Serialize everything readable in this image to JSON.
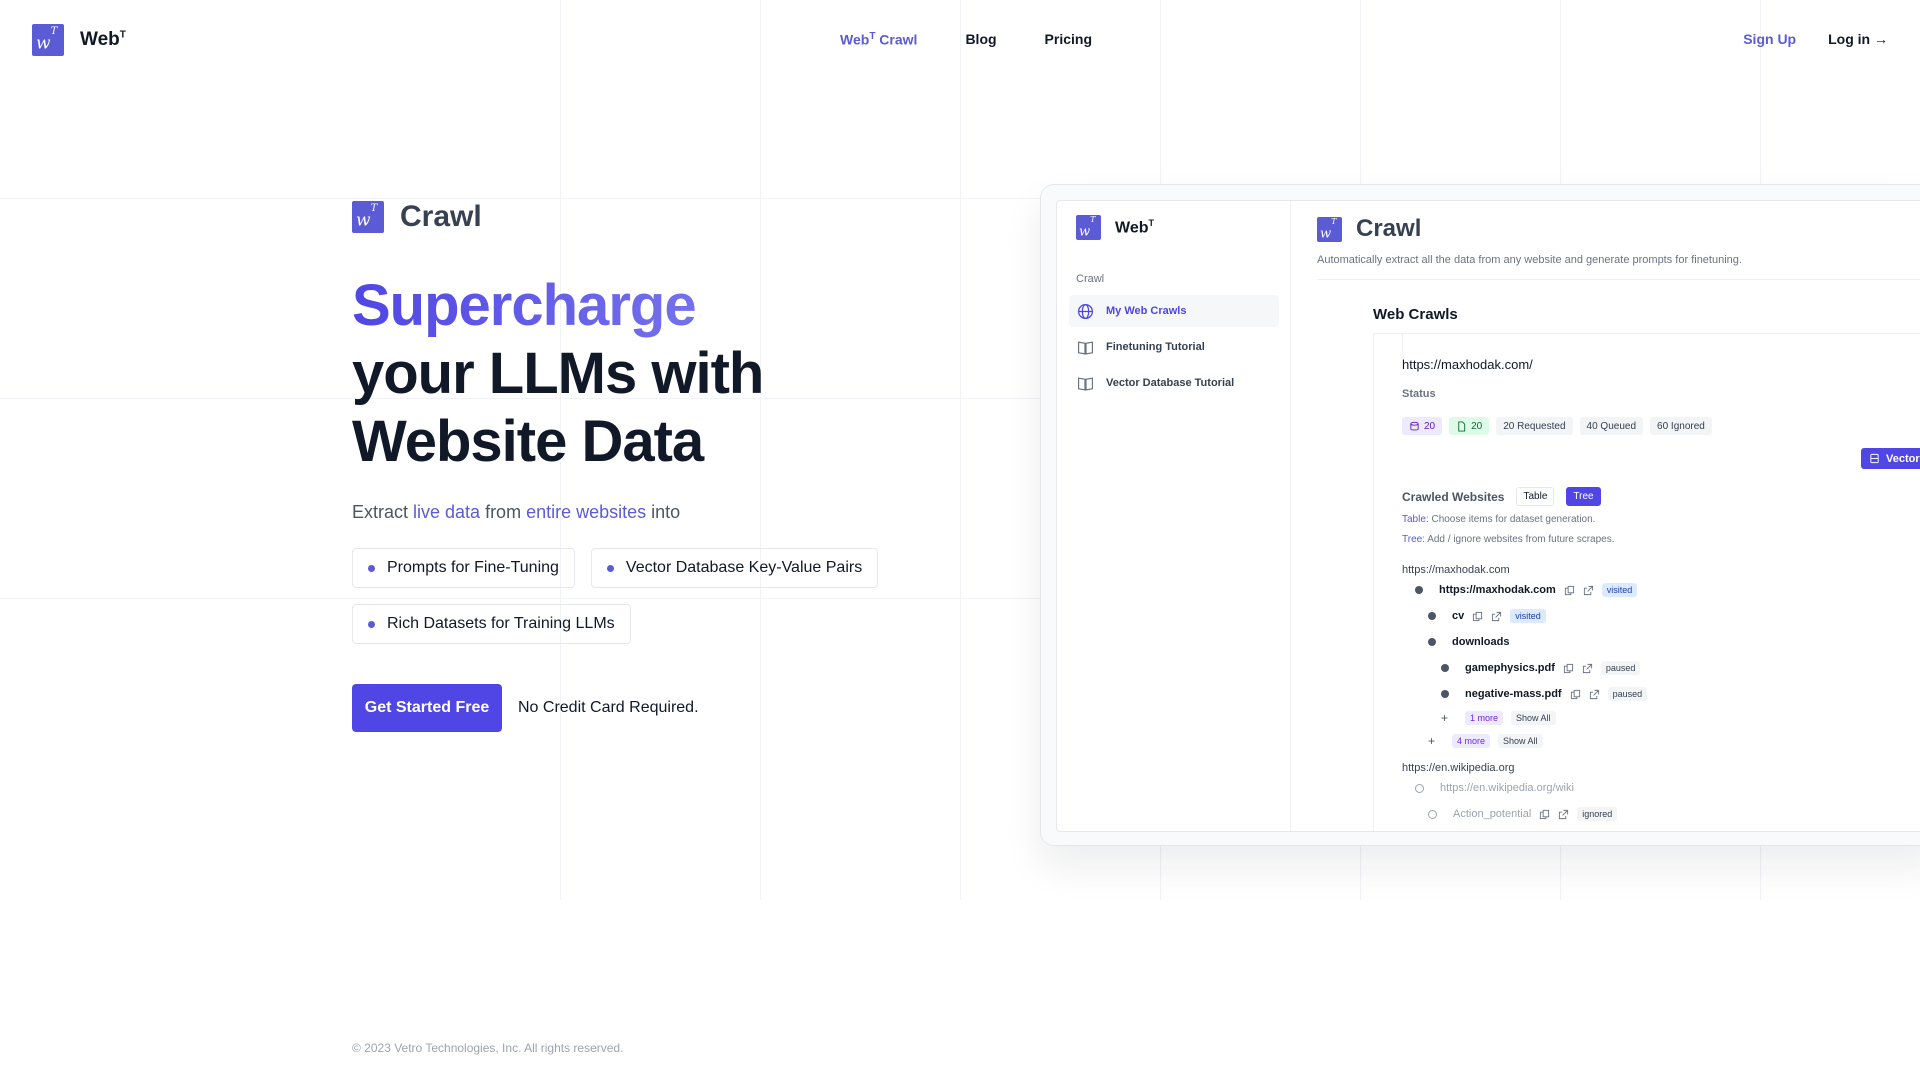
{
  "nav": {
    "brand": "Web",
    "brand_sup": "T",
    "links": [
      {
        "label": "Web",
        "sup": "T",
        "suffix": " Crawl"
      },
      {
        "label": "Blog"
      },
      {
        "label": "Pricing"
      }
    ],
    "signup": "Sign Up",
    "login": "Log in →"
  },
  "hero": {
    "product": "Crawl",
    "title_highlight": "Supercharge",
    "title_line2": "your LLMs with",
    "title_line3": "Website Data",
    "sub_prefix": "Extract ",
    "sub_hl1": "live data",
    "sub_mid": " from ",
    "sub_hl2": "entire websites",
    "sub_suffix": " into",
    "pills": [
      "Prompts for Fine-Tuning",
      "Vector Database Key-Value Pairs",
      "Rich Datasets for Training LLMs"
    ],
    "cta": "Get Started Free",
    "cta_note": "No Credit Card Required."
  },
  "footer": "© 2023 Vetro Technologies, Inc. All rights reserved.",
  "preview": {
    "side_brand": "Web",
    "side_brand_sup": "T",
    "side_label": "Crawl",
    "side_items": [
      "My Web Crawls",
      "Finetuning Tutorial",
      "Vector Database Tutorial"
    ],
    "title": "Crawl",
    "desc": "Automatically extract all the data from any website and generate prompts for finetuning.",
    "web_crawls": "Web Crawls",
    "url": "https://maxhodak.com/",
    "status_label": "Status",
    "badges": [
      "20",
      "20",
      "20 Requested",
      "40 Queued",
      "60 Ignored"
    ],
    "vector_btn": "Vector",
    "crawled_title": "Crawled Websites",
    "tab_table": "Table",
    "tab_tree": "Tree",
    "help_table_key": "Table:",
    "help_table": " Choose items for dataset generation.",
    "help_tree_key": "Tree:",
    "help_tree": " Add / ignore websites from future scrapes.",
    "root1": "https://maxhodak.com",
    "n1": "https://maxhodak.com",
    "n1_tag": "visited",
    "n2": "cv",
    "n2_tag": "visited",
    "n3": "downloads",
    "n4": "gamephysics.pdf",
    "n4_tag": "paused",
    "n5": "negative-mass.pdf",
    "n5_tag": "paused",
    "more1": "1 more",
    "show1": "Show All",
    "more2": "4 more",
    "show2": "Show All",
    "root2": "https://en.wikipedia.org",
    "n6": "https://en.wikipedia.org/wiki",
    "n7": "Action_potential",
    "n7_tag": "ignored"
  }
}
